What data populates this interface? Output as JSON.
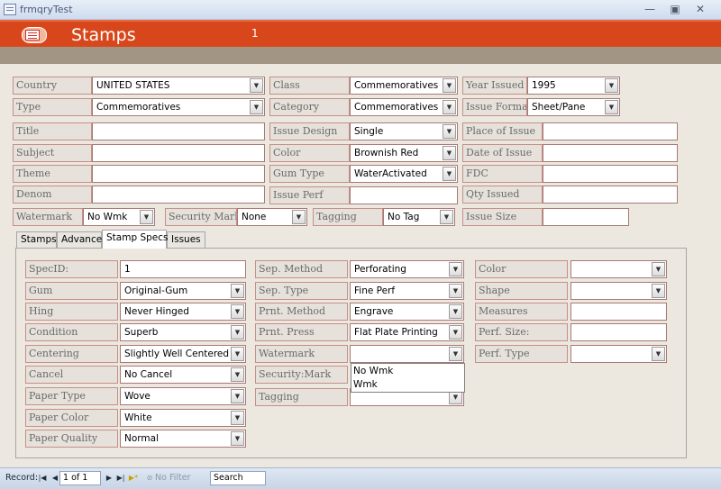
{
  "window": {
    "title": "frmqryTest",
    "min_glyph": "—",
    "max_glyph": "▣",
    "close_glyph": "✕"
  },
  "header": {
    "form_title": "Stamps",
    "record_number": "1"
  },
  "top_section": {
    "country": {
      "label": "Country",
      "value": "UNITED STATES"
    },
    "class": {
      "label": "Class",
      "value": "Commemoratives"
    },
    "year_issued": {
      "label": "Year Issued",
      "value": "1995"
    },
    "type": {
      "label": "Type",
      "value": "Commemoratives"
    },
    "category": {
      "label": "Category",
      "value": "Commemoratives"
    },
    "issue_format": {
      "label": "Issue Format",
      "value": "Sheet/Pane"
    },
    "title": {
      "label": "Title",
      "value": ""
    },
    "issue_design": {
      "label": "Issue Design",
      "value": "Single"
    },
    "place_of_issue": {
      "label": "Place of Issue",
      "value": ""
    },
    "subject": {
      "label": "Subject",
      "value": ""
    },
    "color": {
      "label": "Color",
      "value": "Brownish Red"
    },
    "date_of_issue": {
      "label": "Date of Issue",
      "value": ""
    },
    "theme": {
      "label": "Theme",
      "value": ""
    },
    "gum_type": {
      "label": "Gum Type",
      "value": "WaterActivated"
    },
    "fdc": {
      "label": "FDC",
      "value": ""
    },
    "denom": {
      "label": "Denom",
      "value": ""
    },
    "issue_perf": {
      "label": "Issue Perf",
      "value": ""
    },
    "qty_issued": {
      "label": "Qty Issued",
      "value": ""
    },
    "watermark": {
      "label": "Watermark",
      "value": "No Wmk"
    },
    "security_mark": {
      "label": "Security Mark",
      "value": "None"
    },
    "tagging": {
      "label": "Tagging",
      "value": "No Tag"
    },
    "issue_size": {
      "label": "Issue Size",
      "value": ""
    }
  },
  "tabs": [
    "Stamps",
    "Advance",
    "Stamp Specs",
    "Issues"
  ],
  "active_tab": "Stamp Specs",
  "specs": {
    "spec_id": {
      "label": "SpecID:",
      "value": "1"
    },
    "gum": {
      "label": "Gum",
      "value": "Original-Gum"
    },
    "hing": {
      "label": "Hing",
      "value": "Never Hinged"
    },
    "condition": {
      "label": "Condition",
      "value": "Superb"
    },
    "centering": {
      "label": "Centering",
      "value": "Slightly Well Centered"
    },
    "cancel": {
      "label": "Cancel",
      "value": "No Cancel"
    },
    "paper_type": {
      "label": "Paper Type",
      "value": "Wove"
    },
    "paper_color": {
      "label": "Paper Color",
      "value": "White"
    },
    "paper_quality": {
      "label": "Paper Quality",
      "value": "Normal"
    },
    "sep_method": {
      "label": "Sep. Method",
      "value": "Perforating"
    },
    "sep_type": {
      "label": "Sep. Type",
      "value": "Fine Perf"
    },
    "prnt_method": {
      "label": "Prnt. Method",
      "value": "Engrave"
    },
    "prnt_press": {
      "label": "Prnt. Press",
      "value": "Flat Plate Printing"
    },
    "watermark": {
      "label": "Watermark",
      "value": ""
    },
    "security_mark": {
      "label": "Security:Mark",
      "value": ""
    },
    "tagging": {
      "label": "Tagging",
      "value": ""
    },
    "color": {
      "label": "Color",
      "value": ""
    },
    "shape": {
      "label": "Shape",
      "value": ""
    },
    "measures": {
      "label": "Measures",
      "value": ""
    },
    "perf_size": {
      "label": "Perf. Size:",
      "value": ""
    },
    "perf_type": {
      "label": "Perf. Type",
      "value": ""
    }
  },
  "watermark_dropdown": [
    "No Wmk",
    "Wmk"
  ],
  "statusbar": {
    "record_label": "Record:",
    "record_position": "1 of 1",
    "filter_label": "No Filter",
    "search_label": "Search"
  }
}
